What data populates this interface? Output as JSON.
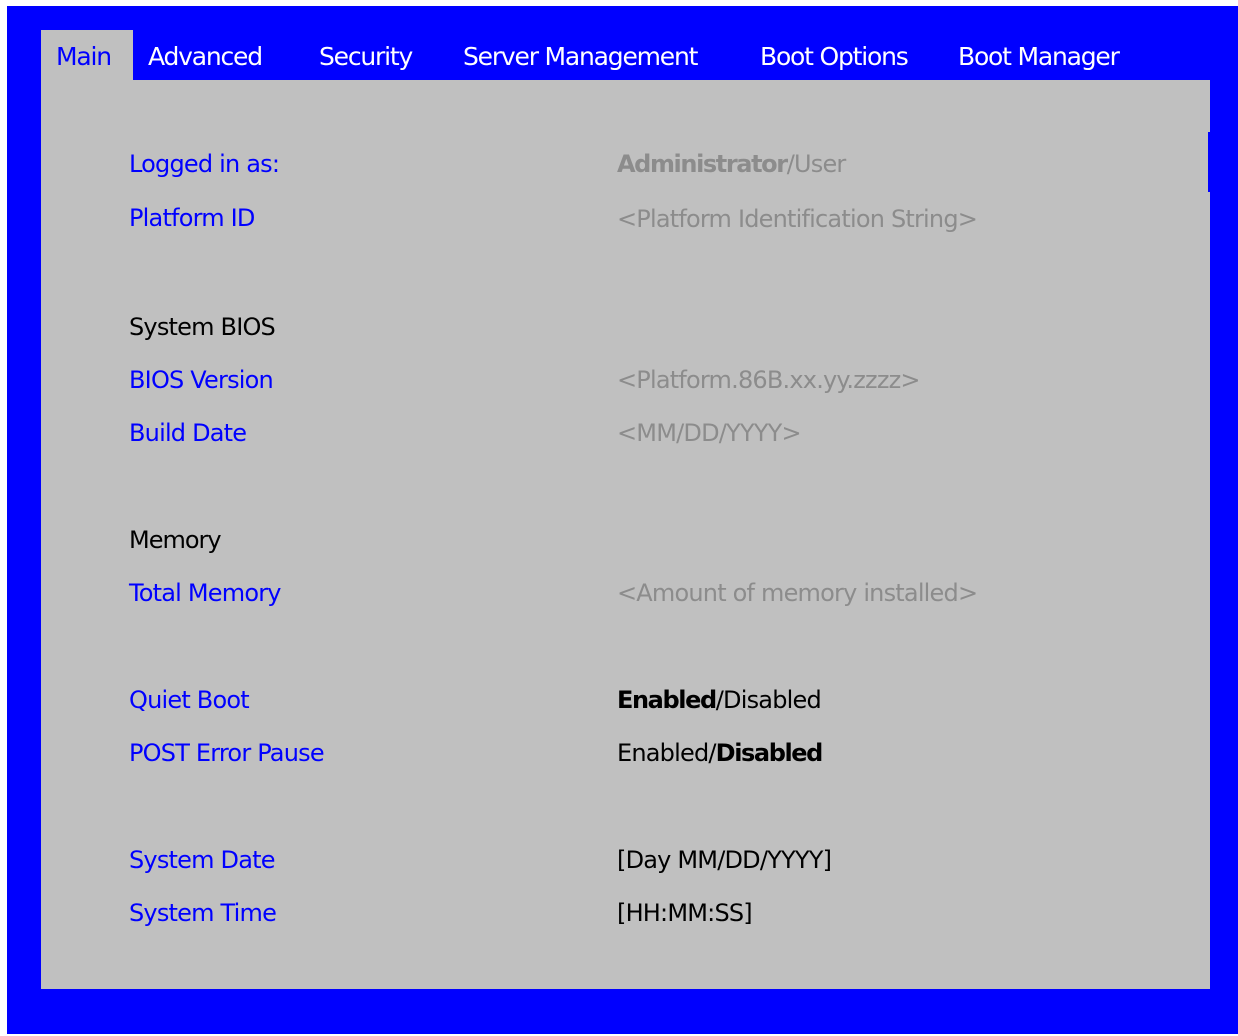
{
  "tabs": [
    {
      "label": "Main",
      "active": true
    },
    {
      "label": "Advanced",
      "active": false
    },
    {
      "label": "Security",
      "active": false
    },
    {
      "label": "Server Management",
      "active": false
    },
    {
      "label": "Boot Options",
      "active": false
    },
    {
      "label": "Boot Manager",
      "active": false
    }
  ],
  "main": {
    "logged_in": {
      "label": "Logged in as:",
      "value_bold": "Administrator",
      "value_rest": "/User"
    },
    "platform_id": {
      "label": "Platform ID",
      "value": "<Platform Identification String>"
    },
    "system_bios_heading": "System BIOS",
    "bios_version": {
      "label": "BIOS Version",
      "value": "<Platform.86B.xx.yy.zzzz>"
    },
    "build_date": {
      "label": "Build Date",
      "value": "<MM/DD/YYYY>"
    },
    "memory_heading": "Memory",
    "total_memory": {
      "label": "Total Memory",
      "value": "<Amount of memory installed>"
    },
    "quiet_boot": {
      "label": "Quiet Boot",
      "value_bold": "Enabled",
      "value_rest": "/Disabled"
    },
    "post_error_pause": {
      "label": "POST Error Pause",
      "value_pre": "Enabled/",
      "value_bold": "Disabled"
    },
    "system_date": {
      "label": "System Date",
      "value": "[Day MM/DD/YYYY]"
    },
    "system_time": {
      "label": "System Time",
      "value": "[HH:MM:SS]"
    }
  },
  "colors": {
    "background": "#0000ff",
    "panel": "#c0c0c0",
    "label": "#0000ff",
    "readonly_value": "#8c8c8c",
    "editable_value": "#000000"
  }
}
